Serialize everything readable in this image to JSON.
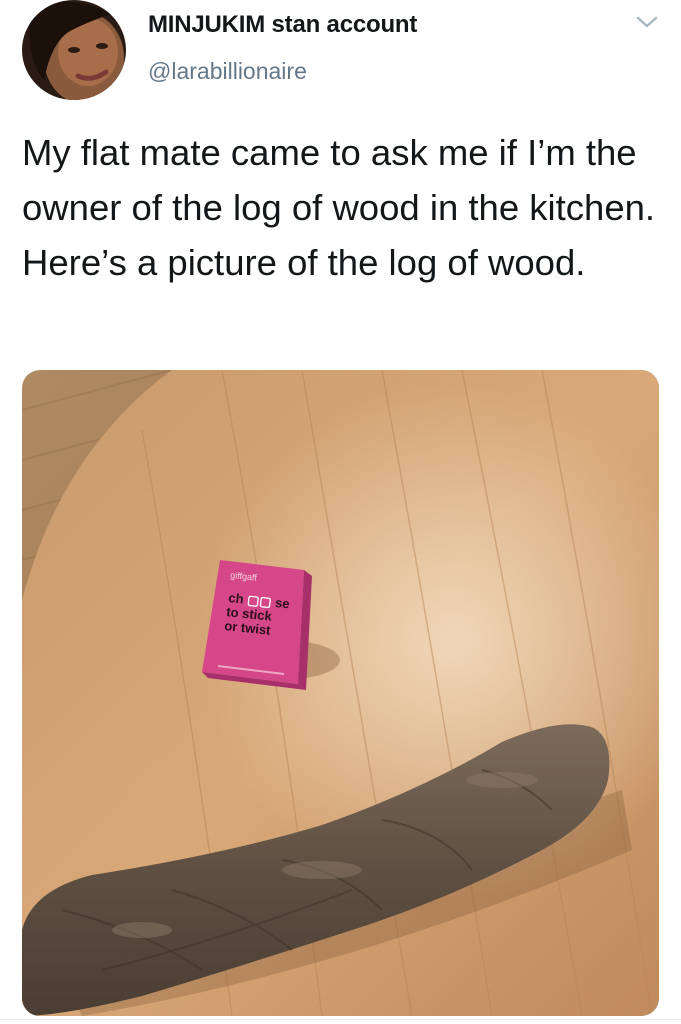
{
  "tweet": {
    "display_name": "MINJUKIM stan account",
    "handle": "@larabillionaire",
    "text": "My flat mate came to ask me if I’m the owner of the log of wood in the kitchen. Here’s a picture of the log of wood.",
    "menu_icon": "chevron-down-icon"
  },
  "photo": {
    "box": {
      "brand": "giffgaff",
      "line1": "ch",
      "line1_end": "se",
      "line2": "to stick",
      "line3": "or twist"
    }
  },
  "colors": {
    "text_primary": "#14171a",
    "text_secondary": "#657786",
    "table_wood": "#c89468",
    "box_pink": "#d6478a",
    "yam_skin": "#6b5a4a"
  }
}
